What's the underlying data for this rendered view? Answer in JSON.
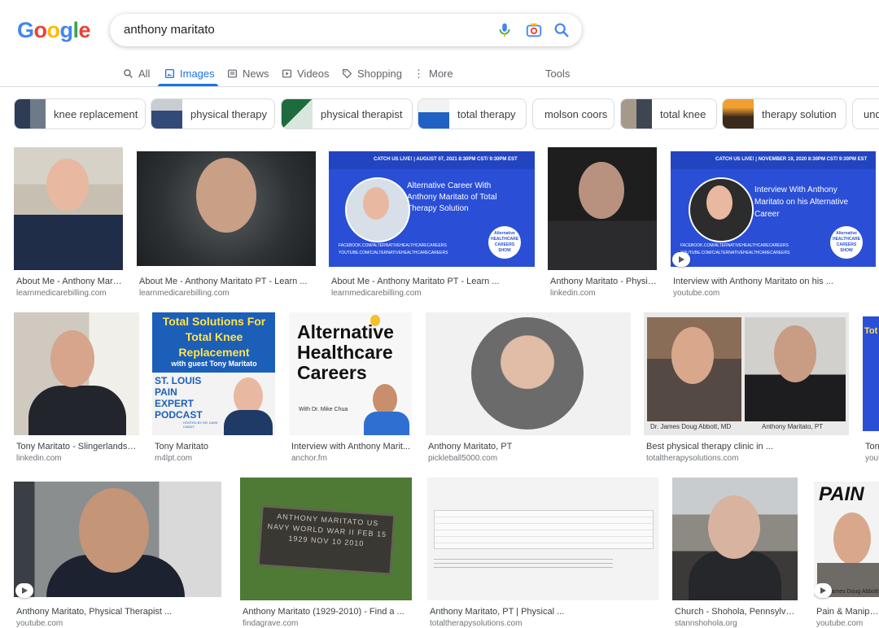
{
  "logo": "Google",
  "search": {
    "query": "anthony maritato"
  },
  "tabs": [
    {
      "label": "All"
    },
    {
      "label": "Images"
    },
    {
      "label": "News"
    },
    {
      "label": "Videos"
    },
    {
      "label": "Shopping"
    },
    {
      "label": "More"
    },
    {
      "label": "Tools"
    }
  ],
  "chips": [
    {
      "label": "knee replacement"
    },
    {
      "label": "physical therapy"
    },
    {
      "label": "physical therapist"
    },
    {
      "label": "total therapy"
    },
    {
      "label": "molson coors"
    },
    {
      "label": "total knee"
    },
    {
      "label": "therapy solution"
    },
    {
      "label": "und"
    }
  ],
  "results": [
    {
      "title": "About Me - Anthony Marit...",
      "source": "learnmedicarebilling.com"
    },
    {
      "title": "About Me - Anthony Maritato PT - Learn ...",
      "source": "learnmedicarebilling.com"
    },
    {
      "title": "About Me - Anthony Maritato PT - Learn ...",
      "source": "learnmedicarebilling.com"
    },
    {
      "title": "Anthony Maritato - Physic...",
      "source": "linkedin.com"
    },
    {
      "title": "Interview with Anthony Maritato on his ...",
      "source": "youtube.com"
    },
    {
      "title": "Tony Maritato - Slingerlands, ...",
      "source": "linkedin.com"
    },
    {
      "title": "Tony Maritato",
      "source": "m4lpt.com"
    },
    {
      "title": "Interview with Anthony Marit...",
      "source": "anchor.fm"
    },
    {
      "title": "Anthony Maritato, PT",
      "source": "pickleball5000.com"
    },
    {
      "title": "Best physical therapy clinic in ...",
      "source": "totaltherapysolutions.com"
    },
    {
      "title": "Ton",
      "source": "yout"
    },
    {
      "title": "Anthony Maritato, Physical Therapist ...",
      "source": "youtube.com"
    },
    {
      "title": "Anthony Maritato (1929-2010) - Find a ...",
      "source": "findagrave.com"
    },
    {
      "title": "Anthony Maritato, PT | Physical ...",
      "source": "totaltherapysolutions.com"
    },
    {
      "title": "Church - Shohola, Pennsylvania",
      "source": "stannshohola.org"
    },
    {
      "title": "Pain & Manipulat",
      "source": "youtube.com"
    }
  ],
  "image_text": {
    "banner1_top": "CATCH US LIVE! | AUGUST 07, 2021 8:30PM CST/ 9:30PM EST",
    "banner1_main": "Alternative Career With Anthony Maritato of Total Therapy Solution",
    "banner1_footer": "FACEBOOK.COM/ALTERNATIVEHEALTHCARECAREERS YOUTUBE.COM/C/ALTERNATIVEHEALTHCARECAREERS",
    "banner2_top": "CATCH US LIVE! | NOVEMBER 19, 2020 8:30PM CST/ 9:30PM EST",
    "banner2_main": "Interview With Anthony Maritato on his Alternative Career",
    "show_badge": "Alternative HEALTHCARE CAREERS SHOW",
    "podcast_title": "Total Solutions For Total Knee Replacement",
    "podcast_guest": "with guest Tony Maritato",
    "podcast_brand": "ST. LOUIS PAIN EXPERT PODCAST",
    "podcast_host": "HOSTED BY DR. DAVE CANDY",
    "ahc_title": "Alternative Healthcare Careers",
    "ahc_host": "With Dr. Mike Chua",
    "compare_left": "Dr. James Doug Abbott, MD",
    "compare_right": "Anthony Maritato, PT",
    "grave_text": "ANTHONY MARITATO US NAVY WORLD WAR II FEB 15 1929 NOV 10 2010",
    "pain_text": "PAIN",
    "pain_caption": "James Doug Abbott",
    "tot_partial": "Tot"
  },
  "colors": {
    "accent": "#1a73e8",
    "banner_blue": "#2a4fd6",
    "podcast_blue": "#1c5fb8"
  }
}
